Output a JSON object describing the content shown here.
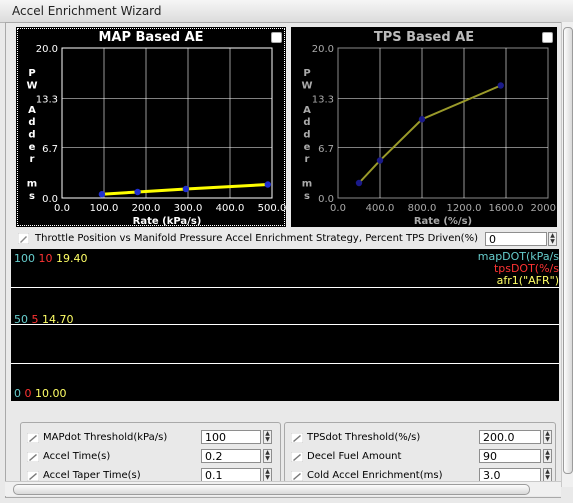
{
  "window": {
    "title": "Accel Enrichment Wizard"
  },
  "map_chart": {
    "title": "MAP Based AE",
    "xlabel": "Rate (kPa/s)",
    "ylabel_chars": [
      "P",
      "W",
      "",
      "A",
      "d",
      "d",
      "e",
      "r",
      "",
      "m",
      "s"
    ],
    "y_ticks": [
      "20.0",
      "13.3",
      "6.7",
      "0.0"
    ],
    "x_ticks": [
      "0.0",
      "100.0",
      "200.0",
      "300.0",
      "400.0",
      "500.0"
    ],
    "toggle_icon": "toggle-icon"
  },
  "tps_chart": {
    "title": "TPS Based AE",
    "xlabel": "Rate (%/s)",
    "ylabel_chars": [
      "P",
      "W",
      "",
      "A",
      "d",
      "d",
      "e",
      "r",
      "",
      "m",
      "s"
    ],
    "y_ticks": [
      "20.0",
      "13.3",
      "6.7",
      "0.0"
    ],
    "x_ticks": [
      "0.0",
      "400.0",
      "800.0",
      "1200.0",
      "1600.0",
      "2000.0"
    ],
    "toggle_icon": "toggle-icon"
  },
  "chart_data": [
    {
      "type": "line",
      "title": "MAP Based AE",
      "xlabel": "Rate (kPa/s)",
      "ylabel": "PW Adder ms",
      "xlim": [
        0,
        500
      ],
      "ylim": [
        0,
        20
      ],
      "x": [
        95,
        180,
        295,
        490
      ],
      "series": [
        {
          "values": [
            0.5,
            0.8,
            1.2,
            1.8
          ],
          "color": "#ffff00"
        }
      ]
    },
    {
      "type": "line",
      "title": "TPS Based AE",
      "xlabel": "Rate (%/s)",
      "ylabel": "PW Adder ms",
      "xlim": [
        0,
        2000
      ],
      "ylim": [
        0,
        20
      ],
      "x": [
        200,
        400,
        800,
        1550
      ],
      "series": [
        {
          "values": [
            2.0,
            5.0,
            10.5,
            15.0
          ],
          "color": "#9a9a2a"
        }
      ]
    }
  ],
  "strategy": {
    "label": "Throttle Position vs Manifold Pressure Accel Enrichment Strategy, Percent TPS Driven(%)",
    "value": "0"
  },
  "gauge": {
    "top": {
      "a": "100",
      "b": "10",
      "c": "19.40"
    },
    "mid": {
      "a": "50",
      "b": "5",
      "c": "14.70"
    },
    "bottom": {
      "a": "0",
      "b": "0",
      "c": "10.00"
    },
    "legend": [
      {
        "label": "mapDOT(kPa/s",
        "color": "#66cccc"
      },
      {
        "label": "tpsDOT(%/s",
        "color": "#ff3333"
      },
      {
        "label": "afr1(\"AFR\")",
        "color": "#ffff66"
      }
    ],
    "colors": {
      "a": "#66cccc",
      "b": "#ff3333",
      "c": "#ffff66"
    }
  },
  "left_params": [
    {
      "label": "MAPdot Threshold(kPa/s)",
      "value": "100"
    },
    {
      "label": "Accel Time(s)",
      "value": "0.2"
    },
    {
      "label": "Accel Taper Time(s)",
      "value": "0.1"
    }
  ],
  "right_params": [
    {
      "label": "TPSdot Threshold(%/s)",
      "value": "200.0"
    },
    {
      "label": "Decel Fuel Amount",
      "value": "90"
    },
    {
      "label": "Cold Accel Enrichment(ms)",
      "value": "3.0"
    }
  ]
}
